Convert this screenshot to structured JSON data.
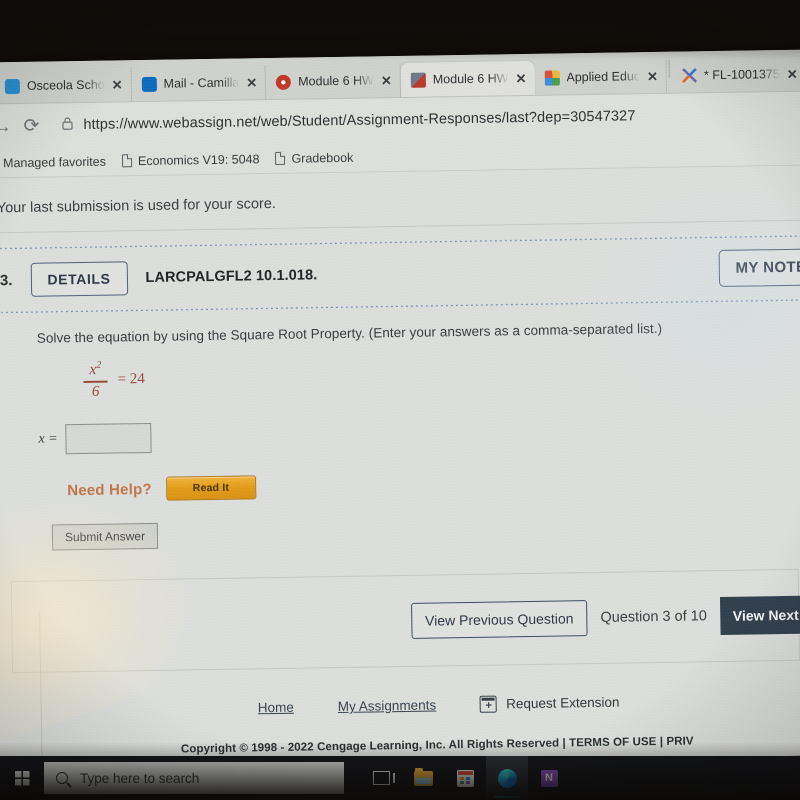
{
  "browser": {
    "tabs": [
      {
        "title": "Osceola Scho",
        "favicon_color": "#2a8fd0",
        "favicon": "school-icon",
        "active": false
      },
      {
        "title": "Mail - Camilla",
        "favicon_color": "#0f6cbd",
        "favicon": "outlook-icon",
        "active": false
      },
      {
        "title": "Module 6 HW",
        "favicon_color": "#c0392b",
        "favicon": "canvas-icon",
        "active": false
      },
      {
        "title": "Module 6 HW",
        "favicon_color": "#b93a2e",
        "favicon": "webassign-icon",
        "active": true
      },
      {
        "title": "Applied Educ",
        "favicon_color": "#e8b93a",
        "favicon": "applied-education-icon",
        "active": false
      },
      {
        "title": "* FL-1001375",
        "favicon_color": "#e06a2b",
        "favicon": "x-logo-icon",
        "active": false
      }
    ],
    "close_glyph": "✕",
    "url": "https://www.webassign.net/web/Student/Assignment-Responses/last?dep=30547327",
    "bookmarks": [
      {
        "label": "Managed favorites",
        "icon": "folder-icon"
      },
      {
        "label": "Economics V19: 5048",
        "icon": "page-icon"
      },
      {
        "label": "Gradebook",
        "icon": "page-icon"
      }
    ],
    "forward_glyph": "→",
    "reload_glyph": "⟳",
    "lock_glyph": "🔒"
  },
  "page": {
    "notice": "Your last submission is used for your score.",
    "question": {
      "number": "3.",
      "details_label": "DETAILS",
      "code": "LARCPALGFL2 10.1.018.",
      "my_notes_label": "MY NOTES",
      "prompt": "Solve the equation by using the Square Root Property. (Enter your answers as a comma-separated list.)",
      "equation": {
        "numerator": "x",
        "numerator_exponent": "2",
        "denominator": "6",
        "rest": "= 24"
      },
      "answer_label": "x =",
      "answer_value": "",
      "answer_placeholder": "",
      "need_help_label": "Need Help?",
      "read_it_label": "Read It",
      "submit_label": "Submit Answer"
    },
    "navigation": {
      "previous_label": "View Previous Question",
      "counter": "Question 3 of 10",
      "next_label": "View Next Question"
    },
    "footer_links": [
      {
        "label": "Home"
      },
      {
        "label": "My Assignments"
      },
      {
        "label": "Request Extension",
        "icon": "calendar-plus-icon"
      }
    ],
    "copyright": "Copyright © 1998 - 2022 Cengage Learning, Inc. All Rights Reserved  |  TERMS OF USE  |  PRIV"
  },
  "taskbar": {
    "start_label": "start-button",
    "search_placeholder": "Type here to search",
    "icons": [
      {
        "name": "task-view-icon",
        "active": false
      },
      {
        "name": "file-explorer-icon",
        "active": false
      },
      {
        "name": "microsoft-store-icon",
        "active": false
      },
      {
        "name": "microsoft-edge-icon",
        "active": true
      },
      {
        "name": "onenote-icon",
        "active": false
      }
    ]
  },
  "colors": {
    "accent_dark": "#33414f",
    "need_help": "#c0764a",
    "read_it": "#e09a18",
    "equation": "#9b4a3d",
    "page_bg": "#dcdedb"
  }
}
